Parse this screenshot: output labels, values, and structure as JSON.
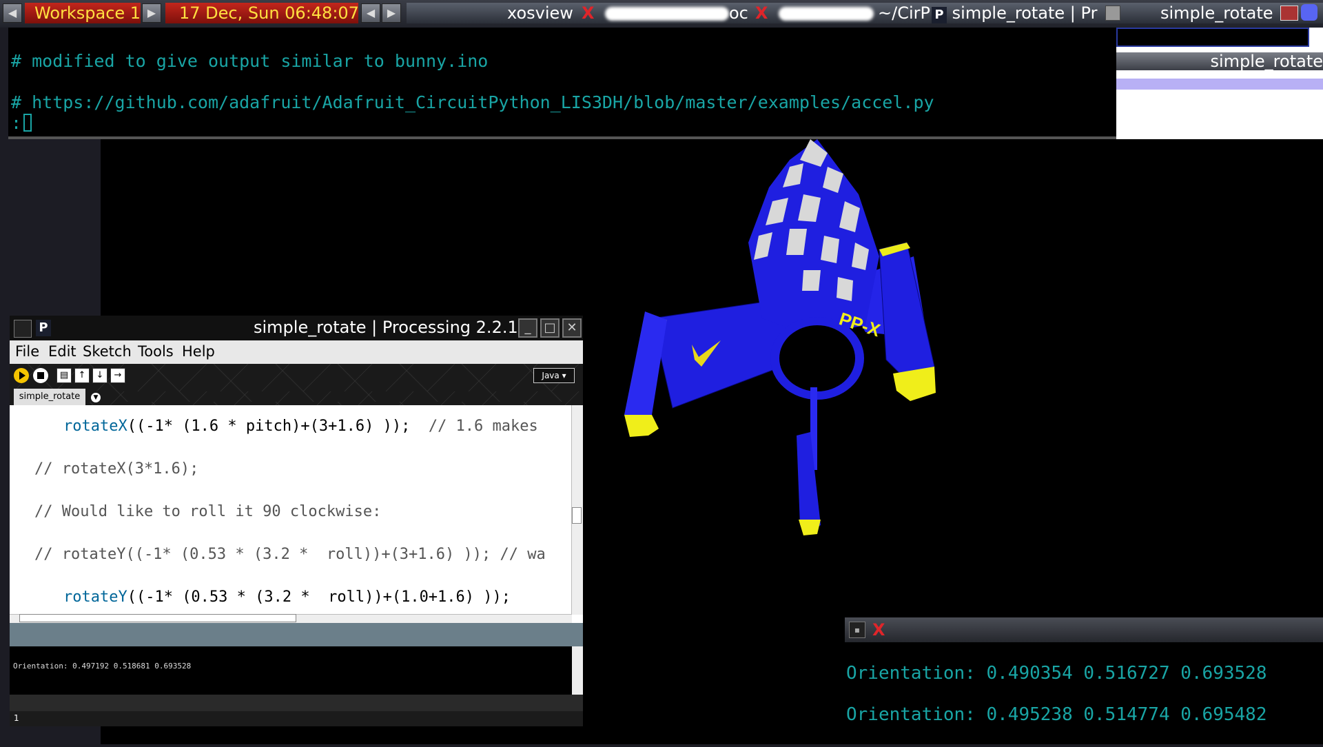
{
  "panel": {
    "workspace": "Workspace 1",
    "clock": "17 Dec, Sun 06:48:07",
    "tasks": {
      "xosview": "xosview",
      "terminal1_suffix": "oc",
      "terminal2_suffix": "~/CirP",
      "processing_task": "simple_rotate | Pr",
      "sketch_task": "simple_rotate"
    }
  },
  "terminal": {
    "line1": "# modified to give output similar to bunny.ino",
    "line2": "# https://github.com/adafruit/Adafruit_CircuitPython_LIS3DH/blob/master/examples/accel.py",
    "prompt": ":"
  },
  "right_window": {
    "title": "simple_rotate"
  },
  "rocket": {
    "label": "PP-X",
    "body_color": "#1f1fe0",
    "accent_color": "#f0ee1a"
  },
  "processing": {
    "title": "simple_rotate | Processing 2.2.1",
    "menu": [
      "File",
      "Edit",
      "Sketch",
      "Tools",
      "Help"
    ],
    "mode": "Java ▾",
    "tab": "simple_rotate",
    "code": {
      "l1_fn": "rotateX",
      "l1_rest": "((-1* (1.6 * pitch)+(3+1.6) ));",
      "l1_comment": "  // 1.6 makes",
      "l2": "// rotateX(3*1.6);",
      "l3": "// Would like to roll it 90 clockwise:",
      "l4": "// rotateY((-1* (0.53 * (3.2 *  roll))+(3+1.6) )); // wa",
      "l5_fn": "rotateY",
      "l5_rest": "((-1* (0.53 * (3.2 *  roll))+(1.0+1.6) ));"
    },
    "console": "Orientation: 0.497192 0.518681 0.693528",
    "line_number": "1"
  },
  "output": {
    "line1": "Orientation: 0.490354 0.516727 0.693528",
    "line2": "Orientation: 0.495238 0.514774 0.695482"
  }
}
